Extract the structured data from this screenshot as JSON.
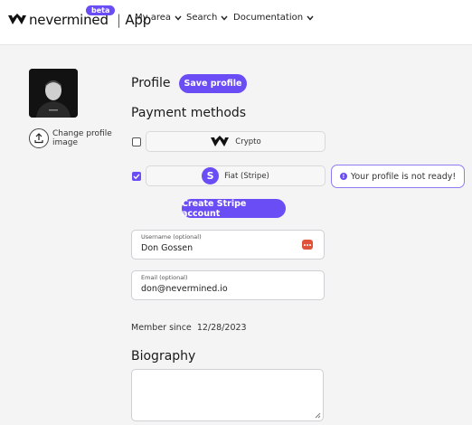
{
  "header": {
    "brand": "nevermined",
    "app_label": "App",
    "beta_badge": "beta",
    "nav": [
      {
        "label": "My area"
      },
      {
        "label": "Search"
      },
      {
        "label": "Documentation"
      }
    ]
  },
  "sidebar": {
    "change_image_label": "Change profile image"
  },
  "profile": {
    "title": "Profile",
    "save_label": "Save profile"
  },
  "payment": {
    "title": "Payment methods",
    "methods": [
      {
        "label": "Crypto",
        "checked": false,
        "icon": "nevermined-logo-icon"
      },
      {
        "label": "Fiat (Stripe)",
        "checked": true,
        "icon": "stripe-icon"
      }
    ],
    "stripe_icon_letter": "S",
    "alert": "Your profile is not ready!",
    "create_stripe_label": "Create Stripe account"
  },
  "form": {
    "username": {
      "label": "Username (optional)",
      "value": "Don Gossen"
    },
    "email": {
      "label": "Email (optional)",
      "value": "don@nevermined.io"
    }
  },
  "member_since": {
    "label": "Member since",
    "date": "12/28/2023"
  },
  "biography": {
    "title": "Biography",
    "value": ""
  },
  "colors": {
    "accent": "#6a4df4",
    "background": "#f4f4f5",
    "badge_red": "#e0533b"
  }
}
